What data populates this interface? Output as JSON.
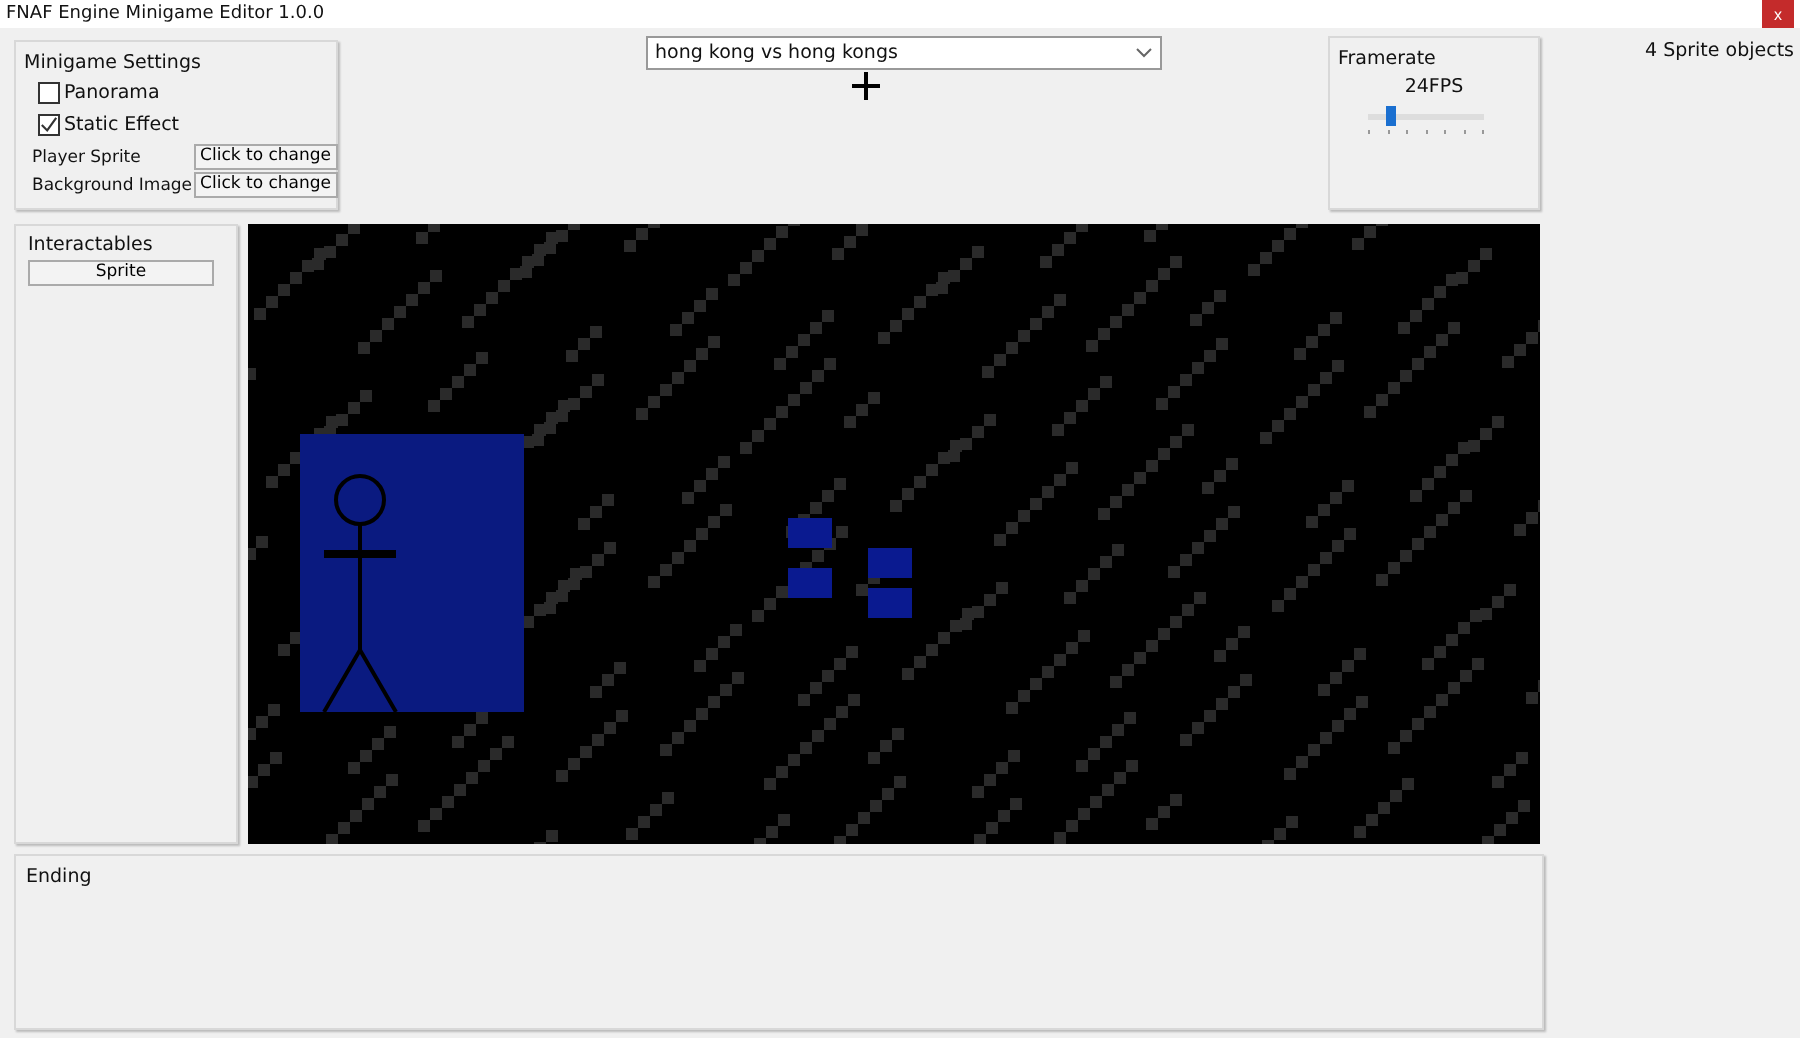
{
  "window": {
    "title": "FNAF Engine Minigame Editor 1.0.0",
    "close": "x"
  },
  "minigame_settings": {
    "title": "Minigame Settings",
    "options": [
      {
        "label": "Panorama",
        "checked": false
      },
      {
        "label": "Static Effect",
        "checked": true
      }
    ],
    "images": [
      {
        "label": "Player Sprite",
        "button": "Click to change"
      },
      {
        "label": "Background Image",
        "button": "Click to change"
      }
    ]
  },
  "minigame_select": {
    "value": "hong kong vs hong kongs"
  },
  "framerate": {
    "title": "Framerate",
    "reading": "24FPS",
    "level": 0.2
  },
  "sprite_count": "4 Sprite objects",
  "interactables": {
    "title": "Interactables",
    "items": [
      "Sprite"
    ]
  },
  "ending": {
    "title": "Ending"
  }
}
